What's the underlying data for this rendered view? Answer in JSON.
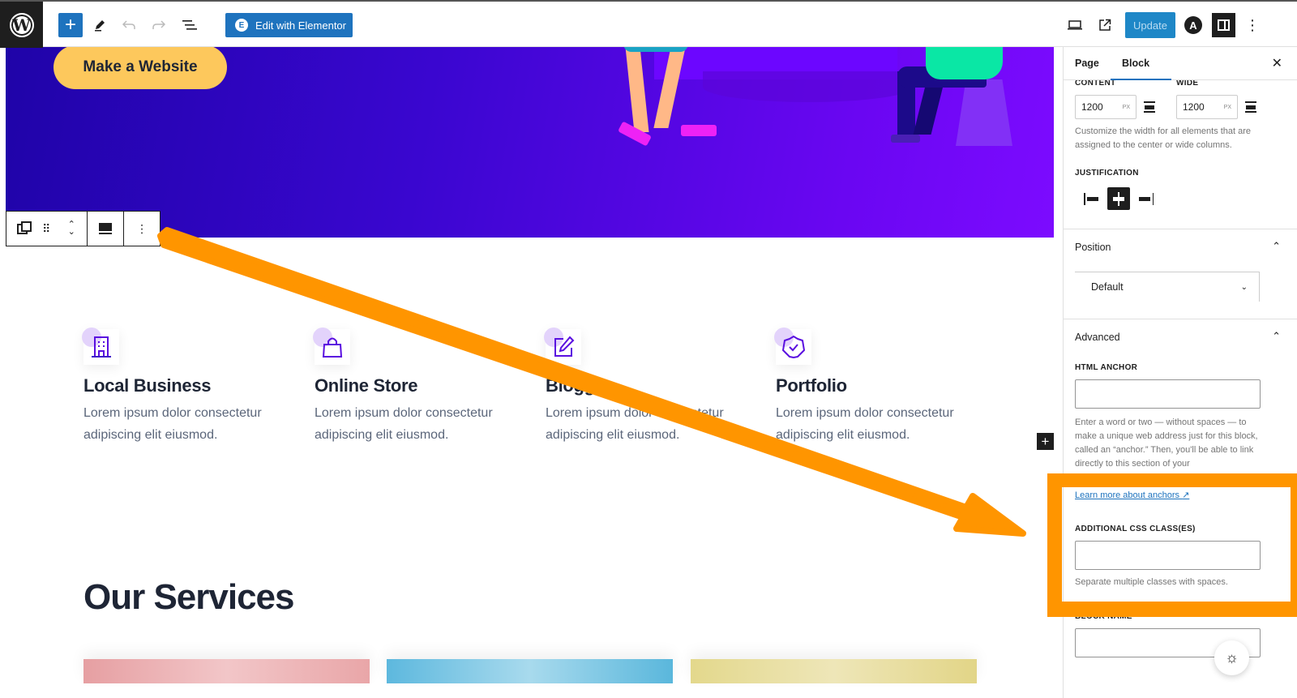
{
  "topbar": {
    "logo": "W",
    "add_block_icon": "+",
    "tools_icon": "pencil-icon",
    "undo_icon": "undo-icon",
    "redo_icon": "redo-icon",
    "list_view_icon": "list-view-icon",
    "elementor_button": "Edit with Elementor",
    "elementor_icon": "E",
    "preview_icon": "laptop-icon",
    "view_post_icon": "external-link-icon",
    "update_button": "Update",
    "astra_icon": "A",
    "settings_icon": "sidebar-toggle-icon",
    "more_icon": "⋮"
  },
  "hero": {
    "cta_label": "Make a Website"
  },
  "block_toolbar": {
    "duplicate_icon": "duplicate-icon",
    "drag_icon": "⠿",
    "move_up": "⌃",
    "move_down": "⌄",
    "align_icon": "align-icon",
    "options_icon": "⋮"
  },
  "features": [
    {
      "title": "Local Business",
      "text": "Lorem ipsum dolor consectetur adipiscing elit eiusmod.",
      "icon": "building-icon"
    },
    {
      "title": "Online Store",
      "text": "Lorem ipsum dolor consectetur adipiscing elit eiusmod.",
      "icon": "shopping-bag-icon"
    },
    {
      "title": "Blogger",
      "text": "Lorem ipsum dolor consectetur adipiscing elit eiusmod.",
      "icon": "edit-icon"
    },
    {
      "title": "Portfolio",
      "text": "Lorem ipsum dolor consectetur adipiscing elit eiusmod.",
      "icon": "badge-check-icon"
    }
  ],
  "services": {
    "title": "Our Services"
  },
  "inserter": "+",
  "sidebar": {
    "tabs": [
      {
        "label": "Page",
        "active": false
      },
      {
        "label": "Block",
        "active": true
      }
    ],
    "close_icon": "✕",
    "layout": {
      "content_label": "CONTENT",
      "content_value": "1200",
      "content_unit": "PX",
      "wide_label": "WIDE",
      "wide_value": "1200",
      "wide_unit": "PX",
      "help": "Customize the width for all elements that are assigned to the center or wide columns.",
      "justification_label": "JUSTIFICATION",
      "justification_options": [
        "left",
        "center",
        "right"
      ],
      "justification_selected": "center"
    },
    "position": {
      "title": "Position",
      "select_value": "Default",
      "expanded": true
    },
    "advanced": {
      "title": "Advanced",
      "expanded": true,
      "html_anchor_label": "HTML ANCHOR",
      "html_anchor_value": "",
      "html_anchor_help": "Enter a word or two — without spaces — to make a unique web address just for this block, called an “anchor.” Then, you'll be able to link directly to this section of your",
      "learn_more": "Learn more about anchors",
      "css_class_label": "ADDITIONAL CSS CLASS(ES)",
      "css_class_value": "",
      "css_class_help": "Separate multiple classes with spaces.",
      "block_name_label": "BLOCK NAME",
      "block_name_value": ""
    }
  },
  "annotation": {
    "color": "#ff9500",
    "arrow_target": "additional-css-class-section"
  },
  "fab_icon": "sun-icon"
}
